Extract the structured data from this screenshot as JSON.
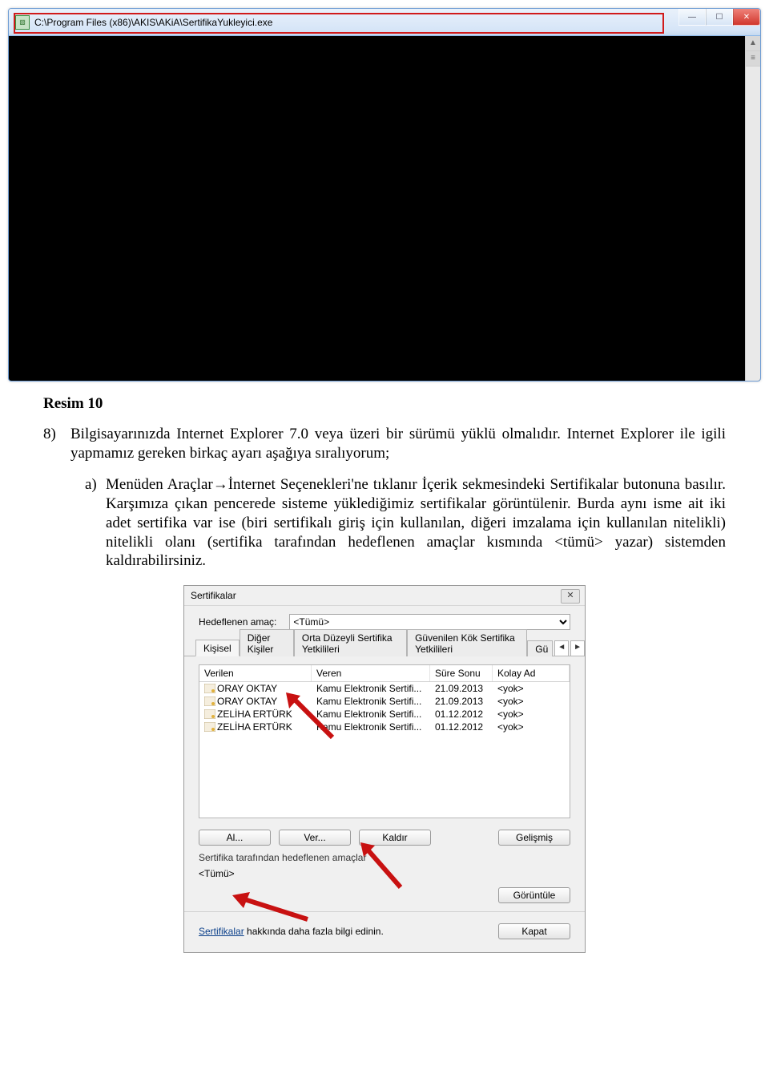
{
  "console": {
    "title": "C:\\Program Files (x86)\\AKIS\\AKiA\\SertifikaYukleyici.exe",
    "icon_glyph": "▧"
  },
  "caption": "Resim 10",
  "list_number": "8)",
  "paragraph1": "Bilgisayarınızda Internet Explorer 7.0 veya üzeri bir sürümü yüklü olmalıdır. Internet Explorer ile igili yapmamız gereken birkaç ayarı aşağıya sıralıyorum;",
  "sublabel": "a)",
  "subparagraph_parts": {
    "p1": "Menüden Araçlar",
    "arrow": "→",
    "p2": "İnternet Seçenekleri'ne tıklanır İçerik sekmesindeki Sertifikalar butonuna basılır. Karşımıza çıkan pencerede sisteme yüklediğimiz sertifikalar görüntülenir. Burda aynı isme ait iki adet sertifika var ise (biri sertifikalı giriş için kullanılan, diğeri imzalama için kullanılan nitelikli) nitelikli olanı (sertifika tarafından hedeflenen amaçlar kısmında <tümü> yazar) sistemden kaldırabilirsiniz."
  },
  "dialog": {
    "title": "Sertifikalar",
    "purpose_label": "Hedeflenen amaç:",
    "purpose_value": "<Tümü>",
    "tabs": [
      "Kişisel",
      "Diğer Kişiler",
      "Orta Düzeyli Sertifika Yetkilileri",
      "Güvenilen Kök Sertifika Yetkilileri",
      "Güvenilen Yayımcılar"
    ],
    "tabs_visible": [
      "Kişisel",
      "Diğer Kişiler",
      "Orta Düzeyli Sertifika Yetkilileri",
      "Güvenilen Kök Sertifika Yetkilileri"
    ],
    "tab_partial": "Gü",
    "columns": [
      "Verilen",
      "Veren",
      "Süre Sonu",
      "Kolay Ad"
    ],
    "rows": [
      {
        "verilen": "ORAY OKTAY",
        "veren": "Kamu Elektronik Sertifi...",
        "sure": "21.09.2013",
        "kolay": "<yok>"
      },
      {
        "verilen": "ORAY OKTAY",
        "veren": "Kamu Elektronik Sertifi...",
        "sure": "21.09.2013",
        "kolay": "<yok>"
      },
      {
        "verilen": "ZELİHA ERTÜRK",
        "veren": "Kamu Elektronik Sertifi...",
        "sure": "01.12.2012",
        "kolay": "<yok>"
      },
      {
        "verilen": "ZELİHA ERTÜRK",
        "veren": "Kamu Elektronik Sertifi...",
        "sure": "01.12.2012",
        "kolay": "<yok>"
      }
    ],
    "buttons": {
      "import": "Al...",
      "export": "Ver...",
      "remove": "Kaldır",
      "advanced": "Gelişmiş"
    },
    "purposes_box_label": "Sertifika tarafından hedeflenen amaçlar",
    "purposes_value": "<Tümü>",
    "view": "Görüntüle",
    "info_link": "Sertifikalar",
    "info_text": " hakkında daha fazla bilgi edinin.",
    "close": "Kapat"
  }
}
